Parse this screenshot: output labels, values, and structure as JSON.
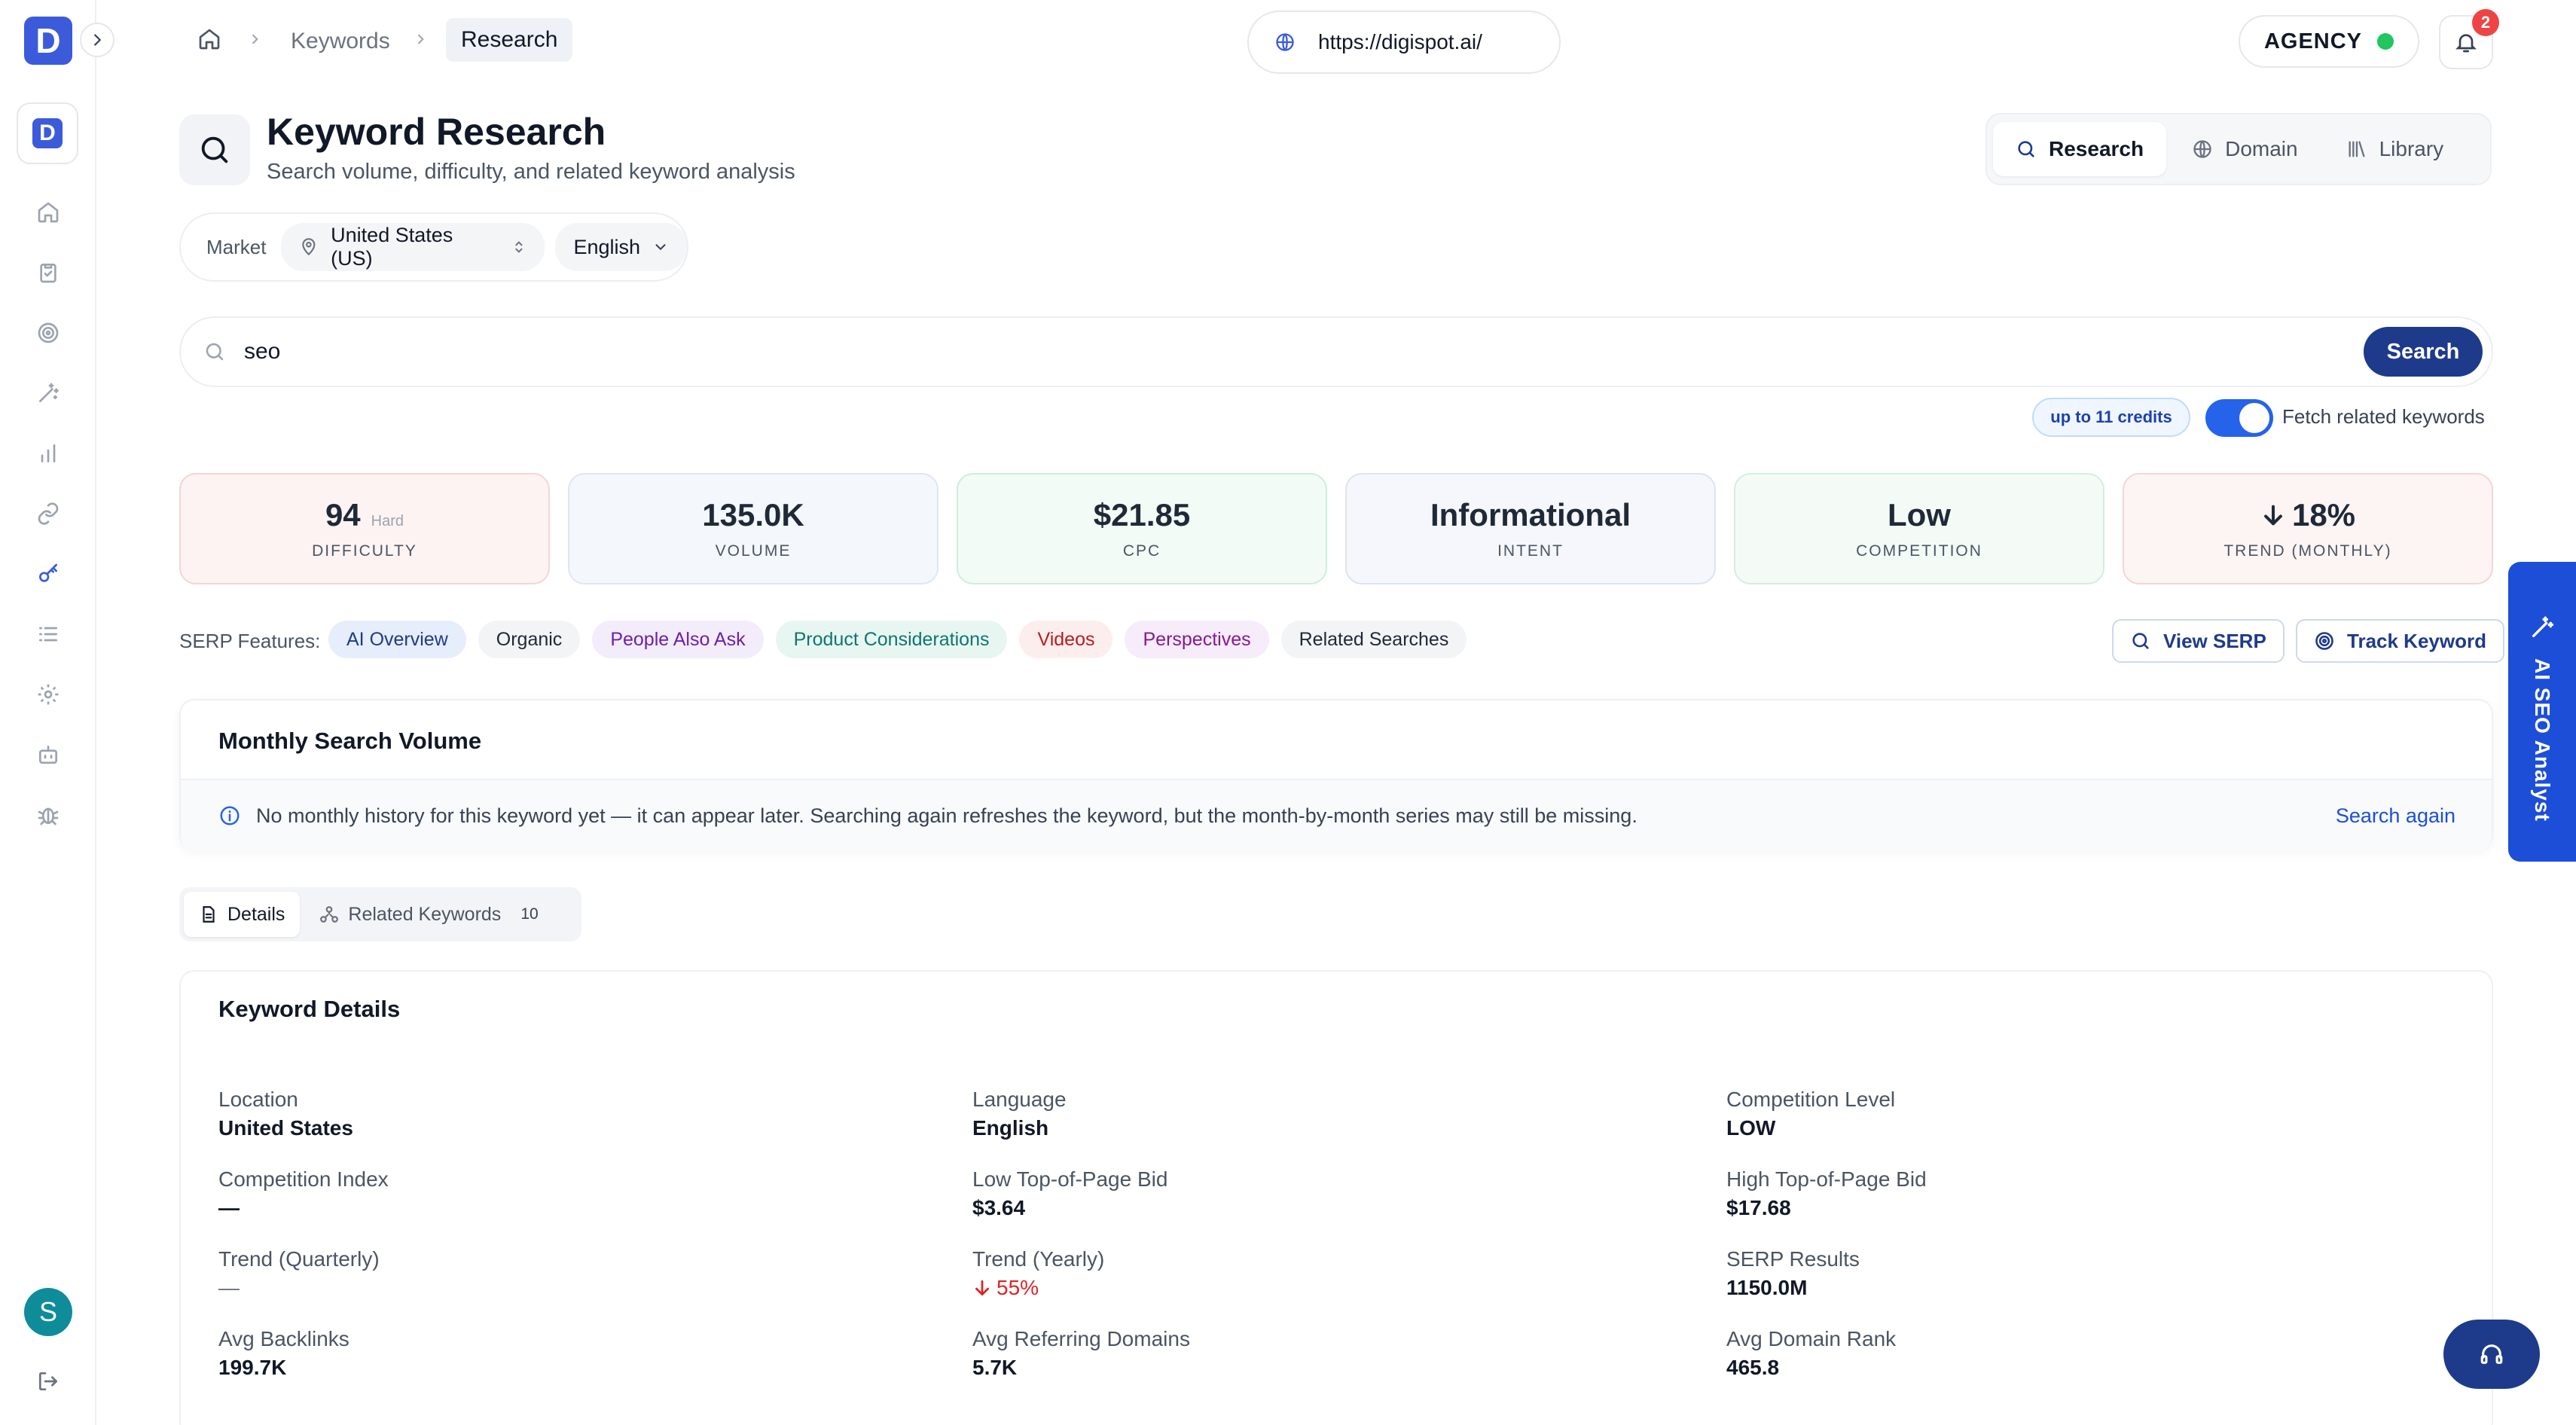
{
  "brand": {
    "logo_letter": "D",
    "workspace_letter": "D",
    "avatar_letter": "S"
  },
  "breadcrumb": {
    "items": [
      "Keywords",
      "Research"
    ]
  },
  "url": "https://digispot.ai/",
  "plan": {
    "label": "AGENCY",
    "status_color": "#22c55e"
  },
  "notifications": {
    "count": "2"
  },
  "page": {
    "title": "Keyword Research",
    "subtitle": "Search volume, difficulty, and related keyword analysis"
  },
  "modes": [
    {
      "label": "Research",
      "icon": "search-icon",
      "active": true
    },
    {
      "label": "Domain",
      "icon": "globe-icon"
    },
    {
      "label": "Library",
      "icon": "library-icon"
    }
  ],
  "market": {
    "label": "Market",
    "country": "United States (US)",
    "language": "English"
  },
  "search": {
    "value": "seo",
    "button": "Search",
    "credits": "up to 11 credits",
    "toggle_label": "Fetch related keywords",
    "toggle_on": true
  },
  "metrics": [
    {
      "value": "94",
      "sub": "Hard",
      "label": "DIFFICULTY",
      "tint": "#fdf3f3",
      "border": "#f3d6d6"
    },
    {
      "value": "135.0K",
      "sub": "",
      "label": "VOLUME",
      "tint": "#f4f7fc",
      "border": "#dfe6f2"
    },
    {
      "value": "$21.85",
      "sub": "",
      "label": "CPC",
      "tint": "#f2fbf6",
      "border": "#cdeedd"
    },
    {
      "value": "Informational",
      "sub": "",
      "label": "INTENT",
      "tint": "#f5f7fc",
      "border": "#dde3f0"
    },
    {
      "value": "Low",
      "sub": "",
      "label": "COMPETITION",
      "tint": "#f4fbf7",
      "border": "#d4eee0"
    },
    {
      "value": "18%",
      "sub": "",
      "label": "TREND (MONTHLY)",
      "tint": "#fdf4f4",
      "border": "#f3d6d6",
      "trend": "down"
    }
  ],
  "serp": {
    "label": "SERP Features:",
    "chips": [
      {
        "label": "AI Overview",
        "bg": "#e6edfb",
        "fg": "#1e3a8a"
      },
      {
        "label": "Organic",
        "bg": "#f3f4f6",
        "fg": "#1f2937"
      },
      {
        "label": "People Also Ask",
        "bg": "#f3ecfb",
        "fg": "#6b21a8"
      },
      {
        "label": "Product Considerations",
        "bg": "#e8f6f1",
        "fg": "#0f766e"
      },
      {
        "label": "Videos",
        "bg": "#fdeeee",
        "fg": "#b91c1c"
      },
      {
        "label": "Perspectives",
        "bg": "#f6ecfa",
        "fg": "#86198f"
      },
      {
        "label": "Related Searches",
        "bg": "#f3f4f6",
        "fg": "#1f2937"
      }
    ],
    "view_serp": "View SERP",
    "track_keyword": "Track Keyword"
  },
  "ai_panel": {
    "label": "AI SEO Analyst"
  },
  "monthly": {
    "title": "Monthly Search Volume",
    "notice": "No monthly history for this keyword yet — it can appear later. Searching again refreshes the keyword, but the month-by-month series may still be missing.",
    "action": "Search again"
  },
  "tabs": [
    {
      "label": "Details",
      "active": true
    },
    {
      "label": "Related Keywords",
      "count": "10"
    }
  ],
  "details": {
    "title": "Keyword Details",
    "fields": [
      {
        "label": "Location",
        "value": "United States"
      },
      {
        "label": "Language",
        "value": "English"
      },
      {
        "label": "Competition Level",
        "value": "LOW"
      },
      {
        "label": "Competition Index",
        "value": "—"
      },
      {
        "label": "Low Top-of-Page Bid",
        "value": "$3.64"
      },
      {
        "label": "High Top-of-Page Bid",
        "value": "$17.68"
      },
      {
        "label": "Trend (Quarterly)",
        "value": "—",
        "muted": true
      },
      {
        "label": "Trend (Yearly)",
        "value": "55%",
        "trend": "down"
      },
      {
        "label": "SERP Results",
        "value": "1150.0M"
      },
      {
        "label": "Avg Backlinks",
        "value": "199.7K"
      },
      {
        "label": "Avg Referring Domains",
        "value": "5.7K"
      },
      {
        "label": "Avg Domain Rank",
        "value": "465.8"
      }
    ]
  },
  "colors": {
    "accent": "#3b5bdb",
    "primary_button": "#1e3a8a",
    "toggle": "#2563eb",
    "ai_tab": "#1d4ed8",
    "negative": "#dc2626"
  }
}
